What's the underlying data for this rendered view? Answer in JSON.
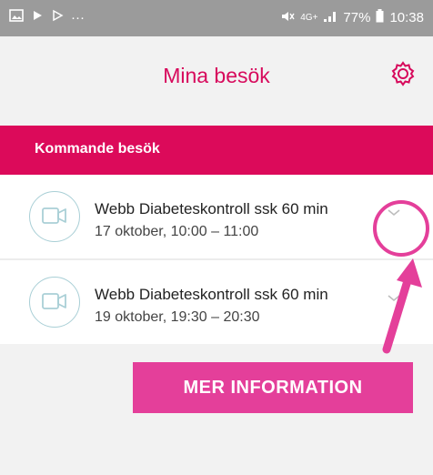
{
  "status_bar": {
    "left_icons": [
      "gallery-icon",
      "play-icon",
      "play-icon",
      "more-dots-icon"
    ],
    "network": "4G+",
    "battery": "77%",
    "time": "10:38"
  },
  "header": {
    "title": "Mina besök",
    "settings_icon": "gear-icon"
  },
  "section": {
    "title": "Kommande besök"
  },
  "appointments": [
    {
      "name": "Webb Diabeteskontroll ssk 60 min",
      "datetime": "17 oktober, 10:00 – 11:00",
      "icon": "video-camera-icon"
    },
    {
      "name": "Webb Diabeteskontroll ssk 60 min",
      "datetime": "19 oktober, 19:30 – 20:30",
      "icon": "video-camera-icon"
    }
  ],
  "annotation": {
    "label": "MER INFORMATION",
    "color": "#e43f9a"
  },
  "colors": {
    "brand": "#dc0a5a",
    "accent": "#e43f9a"
  }
}
